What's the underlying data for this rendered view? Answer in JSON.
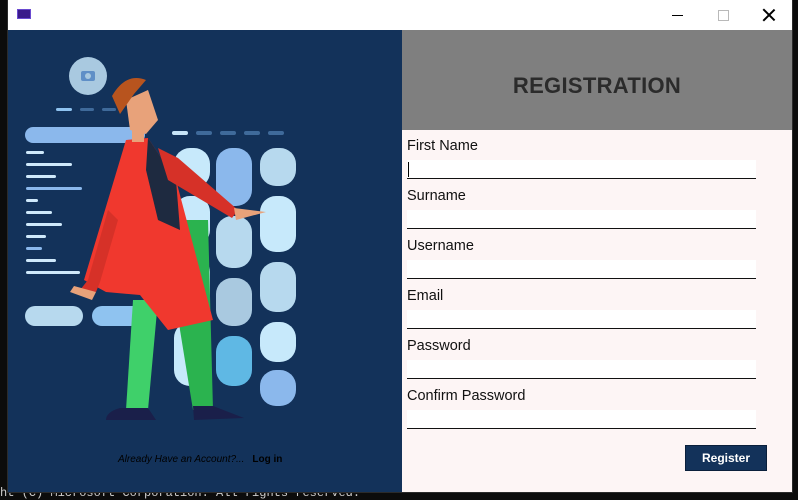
{
  "window": {
    "minimize_label": "—",
    "maximize_label": "☐",
    "close_label": "✕"
  },
  "header": {
    "title": "REGISTRATION"
  },
  "form": {
    "fields": [
      {
        "label": "First Name",
        "value": ""
      },
      {
        "label": "Surname",
        "value": ""
      },
      {
        "label": "Username",
        "value": ""
      },
      {
        "label": "Email",
        "value": ""
      },
      {
        "label": "Password",
        "value": ""
      },
      {
        "label": "Confirm Password",
        "value": ""
      }
    ],
    "register_label": "Register"
  },
  "left_panel": {
    "login_prompt": "Already Have an Account?...",
    "login_link": "Log in"
  },
  "background_terminal": {
    "text": "ht (C) Microsoft Corporation. All rights reserved."
  },
  "colors": {
    "left_panel_bg": "#13325a",
    "header_bg": "#7f7f7f",
    "form_bg": "#fdf5f5",
    "button_bg": "#13325a"
  }
}
